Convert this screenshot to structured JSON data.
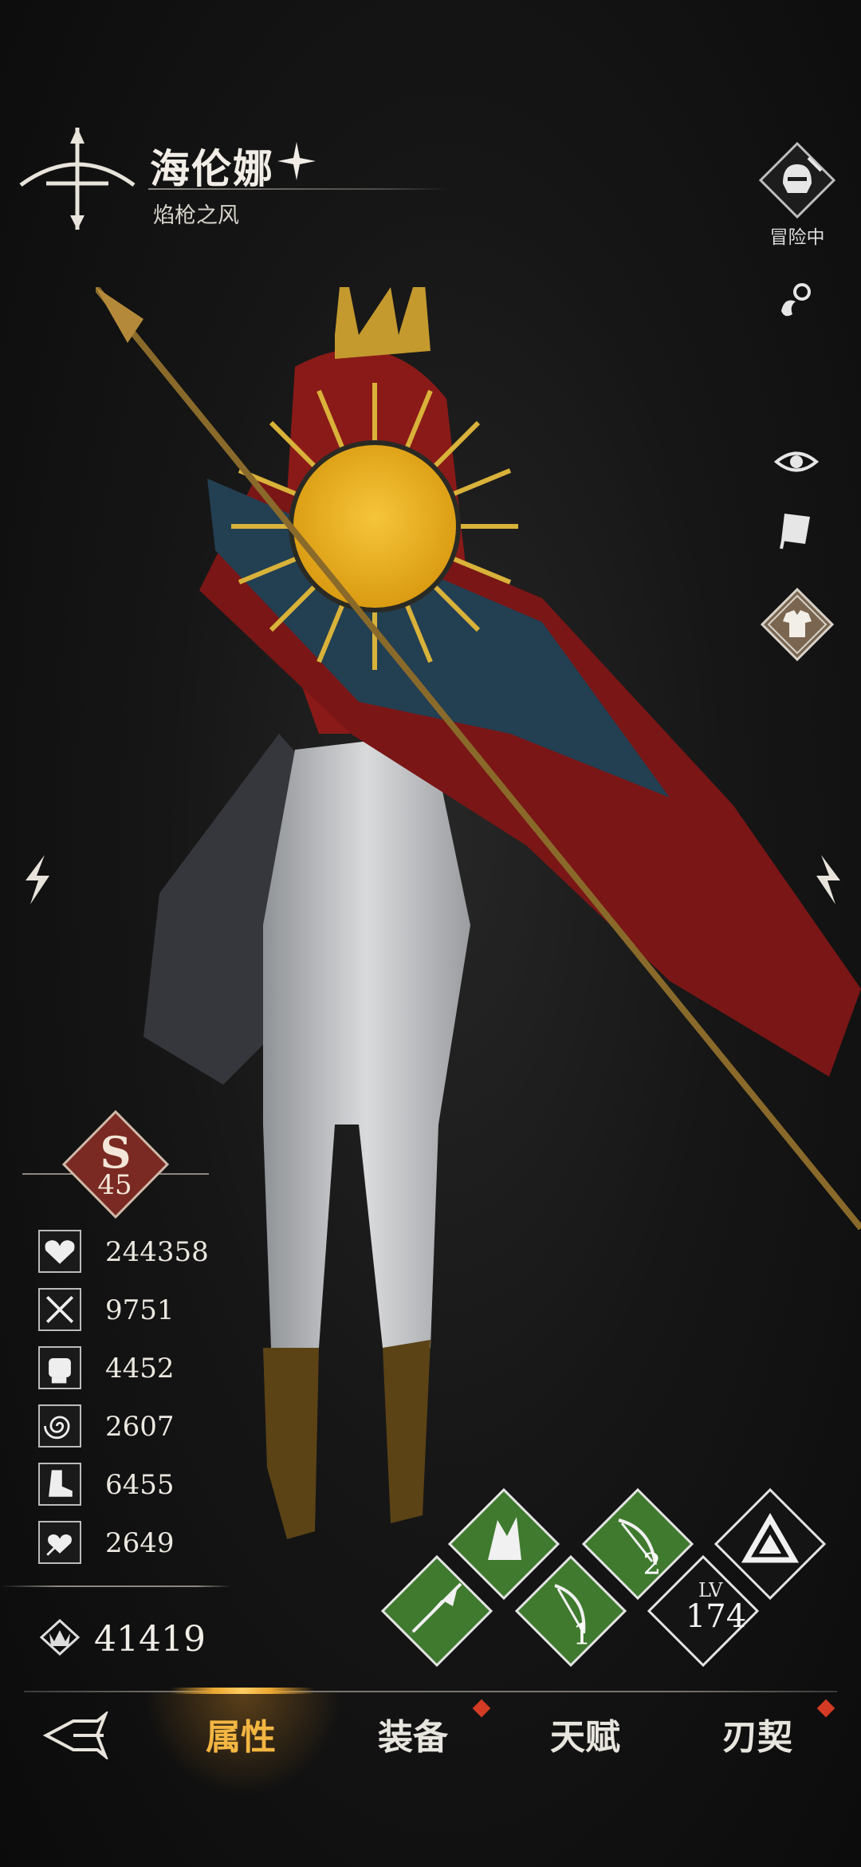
{
  "header": {
    "name": "海伦娜",
    "subtitle": "焰枪之风",
    "class_icon": "bow-cross-emblem-icon",
    "status_label": "冒险中"
  },
  "rank": {
    "letter": "S",
    "level": "45"
  },
  "stats": [
    {
      "icon": "heart-icon",
      "value": "244358"
    },
    {
      "icon": "crossed-swords-icon",
      "value": "9751"
    },
    {
      "icon": "fist-icon",
      "value": "4452"
    },
    {
      "icon": "spiral-icon",
      "value": "2607"
    },
    {
      "icon": "boot-icon",
      "value": "6455"
    },
    {
      "icon": "heart-hand-icon",
      "value": "2649"
    }
  ],
  "power": {
    "icon": "crown-wings-icon",
    "value": "41419"
  },
  "skills": {
    "level_label": "LV",
    "level": "174",
    "slot_1": "1",
    "slot_2": "2"
  },
  "nav": {
    "items": [
      {
        "label": "属性",
        "active": true
      },
      {
        "label": "装备",
        "badge": true
      },
      {
        "label": "天赋",
        "badge": false
      },
      {
        "label": "刃契",
        "badge": true
      }
    ]
  },
  "colors": {
    "accent_gold": "#f3b642",
    "badge_red": "#d33b24",
    "skill_green": "#3f7a2e",
    "rank_red": "#7a2a22"
  }
}
